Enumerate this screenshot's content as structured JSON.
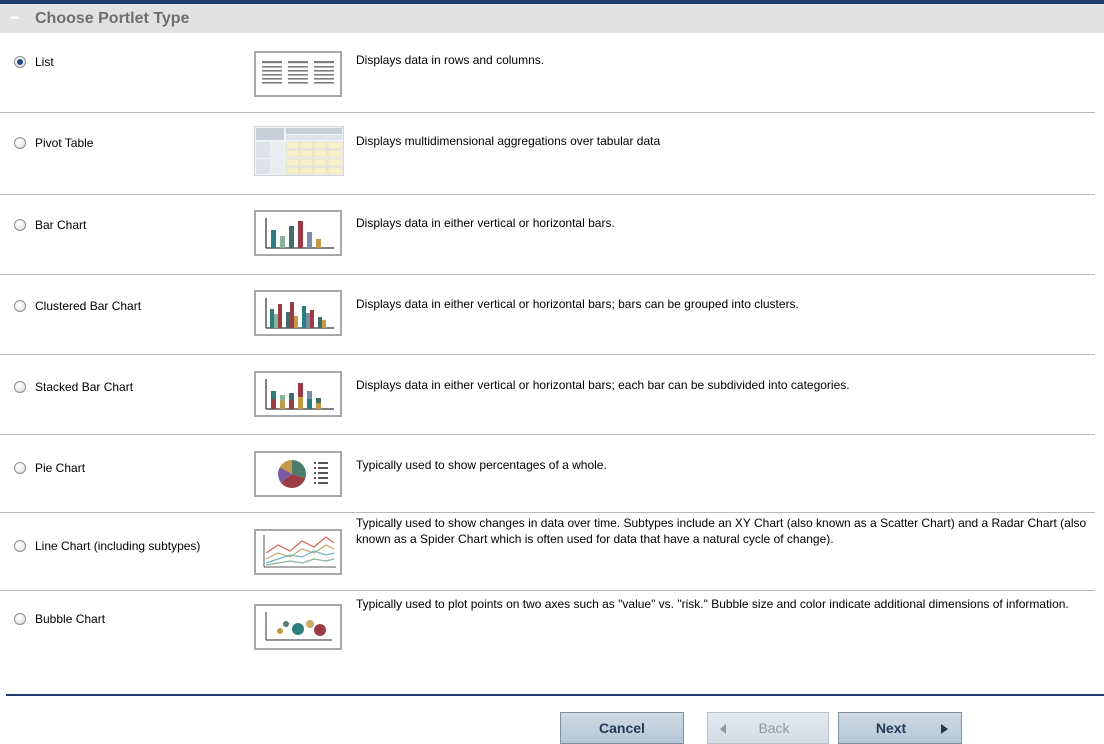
{
  "panel": {
    "title": "Choose Portlet Type"
  },
  "portlet_types": [
    {
      "label": "List",
      "selected": true,
      "icon": "list-thumbnail",
      "description": "Displays data in rows and columns."
    },
    {
      "label": "Pivot Table",
      "selected": false,
      "icon": "pivot-table-thumbnail",
      "description": "Displays multidimensional aggregations over tabular data"
    },
    {
      "label": "Bar Chart",
      "selected": false,
      "icon": "bar-chart-thumbnail",
      "description": "Displays data in either vertical or horizontal bars."
    },
    {
      "label": "Clustered Bar Chart",
      "selected": false,
      "icon": "clustered-bar-chart-thumbnail",
      "description": "Displays data in either vertical or horizontal bars; bars can be grouped into clusters."
    },
    {
      "label": "Stacked Bar Chart",
      "selected": false,
      "icon": "stacked-bar-chart-thumbnail",
      "description": "Displays data in either vertical or horizontal bars; each bar can be subdivided into categories."
    },
    {
      "label": "Pie Chart",
      "selected": false,
      "icon": "pie-chart-thumbnail",
      "description": "Typically used to show percentages of a whole."
    },
    {
      "label": "Line Chart (including subtypes)",
      "selected": false,
      "icon": "line-chart-thumbnail",
      "description": "Typically used to show changes in data over time. Subtypes include an XY Chart (also known as a Scatter Chart) and a Radar Chart (also known as a Spider Chart which is often used for data that have a natural cycle of change)."
    },
    {
      "label": "Bubble Chart",
      "selected": false,
      "icon": "bubble-chart-thumbnail",
      "description": "Typically used to plot points on two axes such as \"value\" vs. \"risk.\" Bubble size and color indicate additional dimensions of information."
    }
  ],
  "buttons": {
    "cancel": "Cancel",
    "back": "Back",
    "next": "Next"
  },
  "colors": {
    "header_rule": "#1c3e6e",
    "header_bg": "#e2e2e2",
    "button_bg": "#b5c7d6"
  }
}
